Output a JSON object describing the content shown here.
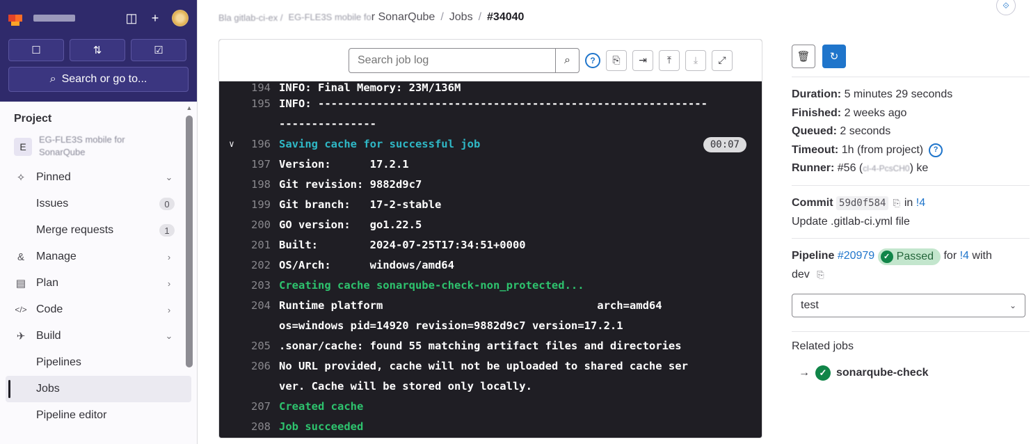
{
  "sidebar": {
    "search_label": "Search or go to...",
    "section_title": "Project",
    "project_initial": "E",
    "project_name_line1": "EG-FLE3S mobile for",
    "project_name_line2": "SonarQube",
    "items": [
      {
        "label": "Pinned",
        "chev": "⌄",
        "icon": "pin-icon",
        "glyph": "✧"
      },
      {
        "label": "Issues",
        "count": "0"
      },
      {
        "label": "Merge requests",
        "count": "1"
      },
      {
        "label": "Manage",
        "chev": "›",
        "icon": "users-icon",
        "glyph": "&"
      },
      {
        "label": "Plan",
        "chev": "›",
        "icon": "calendar-icon",
        "glyph": "▤"
      },
      {
        "label": "Code",
        "chev": "›",
        "icon": "code-icon",
        "glyph": "</>"
      },
      {
        "label": "Build",
        "chev": "⌄",
        "icon": "rocket-icon",
        "glyph": "✈"
      },
      {
        "label": "Pipelines"
      },
      {
        "label": "Jobs"
      },
      {
        "label": "Pipeline editor"
      }
    ]
  },
  "breadcrumb": {
    "group": "Bla gitlab-ci-ex /",
    "project": "EG-FLE3S mobile fo",
    "project_tail": "r SonarQube",
    "sep": "/",
    "jobs": "Jobs",
    "current": "#34040"
  },
  "log": {
    "search_placeholder": "Search job log",
    "lines": [
      {
        "num": "194",
        "text": "INFO: Final Memory: 23M/136M",
        "color": "white"
      },
      {
        "num": "195",
        "text": "INFO: ------------------------------------------------------------",
        "color": "white"
      },
      {
        "num": "",
        "text": "---------------",
        "color": "white"
      },
      {
        "num": "196",
        "text": "Saving cache for successful job",
        "color": "cyan",
        "duration": "00:07",
        "toggle": "∨"
      },
      {
        "num": "197",
        "text": "Version:      17.2.1",
        "color": "white"
      },
      {
        "num": "198",
        "text": "Git revision: 9882d9c7",
        "color": "white"
      },
      {
        "num": "199",
        "text": "Git branch:   17-2-stable",
        "color": "white"
      },
      {
        "num": "200",
        "text": "GO version:   go1.22.5",
        "color": "white"
      },
      {
        "num": "201",
        "text": "Built:        2024-07-25T17:34:51+0000",
        "color": "white"
      },
      {
        "num": "202",
        "text": "OS/Arch:      windows/amd64",
        "color": "white"
      },
      {
        "num": "203",
        "text": "Creating cache sonarqube-check-non_protected...",
        "color": "green"
      },
      {
        "num": "204",
        "text": "Runtime platform                                 arch=amd64",
        "color": "white"
      },
      {
        "num": "",
        "text": "os=windows pid=14920 revision=9882d9c7 version=17.2.1",
        "color": "white"
      },
      {
        "num": "205",
        "text": ".sonar/cache: found 55 matching artifact files and directories",
        "color": "white"
      },
      {
        "num": "206",
        "text": "No URL provided, cache will not be uploaded to shared cache ser",
        "color": "white"
      },
      {
        "num": "",
        "text": "ver. Cache will be stored only locally.",
        "color": "white"
      },
      {
        "num": "207",
        "text": "Created cache",
        "color": "green"
      },
      {
        "num": "208",
        "text": "Job succeeded",
        "color": "green"
      }
    ]
  },
  "details": {
    "duration_label": "Duration:",
    "duration_value": "5 minutes 29 seconds",
    "finished_label": "Finished:",
    "finished_value": "2 weeks ago",
    "queued_label": "Queued:",
    "queued_value": "2 seconds",
    "timeout_label": "Timeout:",
    "timeout_value": "1h (from project)",
    "runner_label": "Runner:",
    "runner_value": "#56 (",
    "runner_blur": "cl-4-PcsCH0",
    "runner_tail": ") ke",
    "commit_label": "Commit",
    "commit_sha": "59d0f584",
    "commit_in": "in",
    "commit_mr": "!4",
    "commit_message": "Update .gitlab-ci.yml file",
    "pipeline_label": "Pipeline",
    "pipeline_id": "#20979",
    "pipeline_status": "Passed",
    "pipeline_for": "for",
    "pipeline_mr": "!4",
    "pipeline_with": "with",
    "pipeline_branch": "dev",
    "stage_select": "test",
    "related_title": "Related jobs",
    "related_job": "sonarqube-check"
  },
  "colors": {
    "brand_dark": "#2f2a6b",
    "primary": "#1f75cb",
    "log_bg": "#1f1e24",
    "log_green": "#2ec36e",
    "log_cyan": "#2fb8c6",
    "success": "#108548"
  }
}
